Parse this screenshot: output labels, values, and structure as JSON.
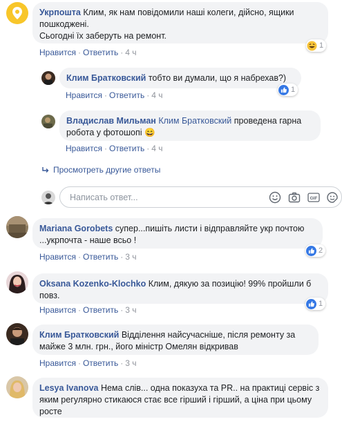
{
  "comments": [
    {
      "author": "Укрпошта",
      "text": "Клим, як нам повідомили наші колеги, дійсно, ящики пошкоджені.",
      "text2": "Сьогодні їх заберуть на ремонт.",
      "like": "Нравится",
      "reply": "Ответить",
      "time": "4 ч",
      "reaction_count": "1",
      "reaction_type": "haha"
    },
    {
      "author": "Клим Братковский",
      "text": "тобто ви думали, що я набрехав?)",
      "like": "Нравится",
      "reply": "Ответить",
      "time": "4 ч",
      "reaction_count": "1",
      "reaction_type": "like"
    },
    {
      "author": "Владислав Мильман",
      "mention": "Клим Братковский",
      "text": "проведена гарна робота у фотошопі",
      "emoji": "😄",
      "like": "Нравится",
      "reply": "Ответить",
      "time": "4 ч"
    },
    {
      "author": "Mariana Gorobets",
      "text": "супер...пишіть листи і відправляйте укр почтою ...укрпочта - наше всьо !",
      "like": "Нравится",
      "reply": "Ответить",
      "time": "3 ч",
      "reaction_count": "2",
      "reaction_type": "like"
    },
    {
      "author": "Oksana Kozenko-Klochko",
      "text": "Клим, дякую за позицію! 99% пройшли б повз.",
      "like": "Нравится",
      "reply": "Ответить",
      "time": "3 ч",
      "reaction_count": "1",
      "reaction_type": "like"
    },
    {
      "author": "Клим Братковский",
      "text": "Відділення найсучасніше, після ремонту за майже 3 млн. грн., його міністр Омелян відкривав",
      "like": "Нравится",
      "reply": "Ответить",
      "time": "3 ч"
    },
    {
      "author": "Lesya Ivanova",
      "text": "Нема слів... одна показуха та PR.. на практиці сервіс з яким регулярно стикаюся стає все гірший і гірший, а ціна при цьому росте"
    }
  ],
  "more_replies": "Просмотреть другие ответы",
  "reply_box": {
    "placeholder": "Написать ответ..."
  },
  "sep": "·",
  "colors": {
    "link": "#385898",
    "bubble": "#f2f3f5",
    "like_blue": "#3578e5",
    "ukrposhta_yellow": "#f8c62a"
  },
  "icons": [
    "location-pin-icon",
    "like-icon",
    "haha-icon",
    "reply-arrow-icon",
    "emoji-icon",
    "camera-icon",
    "gif-icon",
    "sticker-icon"
  ]
}
